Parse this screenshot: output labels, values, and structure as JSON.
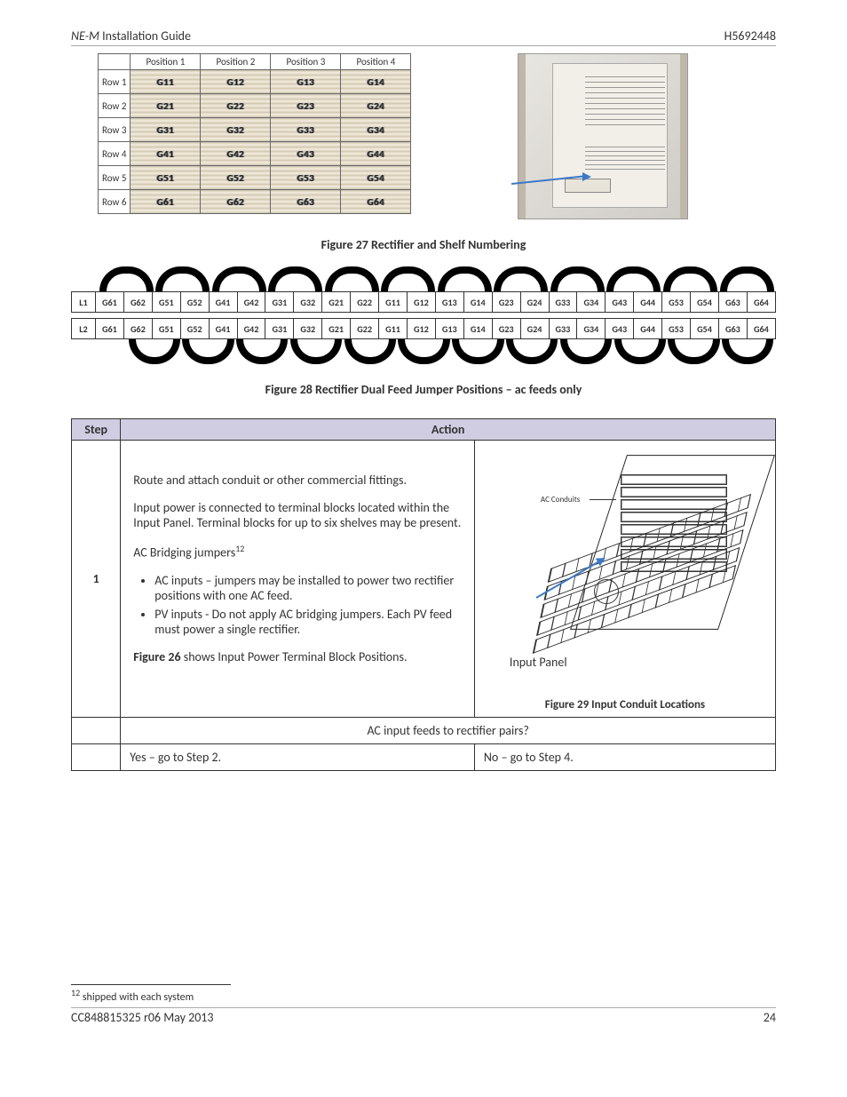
{
  "header": {
    "left_title": "NE-M",
    "left_suffix": " Installation Guide",
    "right": "H5692448"
  },
  "fig27": {
    "positions": [
      "Position 1",
      "Position 2",
      "Position 3",
      "Position 4"
    ],
    "rows": [
      {
        "label": "Row 1",
        "cells": [
          "G11",
          "G12",
          "G13",
          "G14"
        ]
      },
      {
        "label": "Row 2",
        "cells": [
          "G21",
          "G22",
          "G23",
          "G24"
        ]
      },
      {
        "label": "Row 3",
        "cells": [
          "G31",
          "G32",
          "G33",
          "G34"
        ]
      },
      {
        "label": "Row 4",
        "cells": [
          "G41",
          "G42",
          "G43",
          "G44"
        ]
      },
      {
        "label": "Row 5",
        "cells": [
          "G51",
          "G52",
          "G53",
          "G54"
        ]
      },
      {
        "label": "Row 6",
        "cells": [
          "G61",
          "G62",
          "G63",
          "G64"
        ]
      }
    ],
    "caption": "Figure 27 Rectifier and Shelf Numbering"
  },
  "fig28": {
    "rows": [
      {
        "head": "L1",
        "cells": [
          "G61",
          "G62",
          "G51",
          "G52",
          "G41",
          "G42",
          "G31",
          "G32",
          "G21",
          "G22",
          "G11",
          "G12",
          "G13",
          "G14",
          "G23",
          "G24",
          "G33",
          "G34",
          "G43",
          "G44",
          "G53",
          "G54",
          "G63",
          "G64"
        ]
      },
      {
        "head": "L2",
        "cells": [
          "G61",
          "G62",
          "G51",
          "G52",
          "G41",
          "G42",
          "G31",
          "G32",
          "G21",
          "G22",
          "G11",
          "G12",
          "G13",
          "G14",
          "G23",
          "G24",
          "G33",
          "G34",
          "G43",
          "G44",
          "G53",
          "G54",
          "G63",
          "G64"
        ]
      }
    ],
    "caption": "Figure 28 Rectifier Dual Feed Jumper Positions – ac feeds only"
  },
  "step_table": {
    "headers": {
      "step": "Step",
      "action": "Action"
    },
    "step_number": "1",
    "body": {
      "p1": "Route and attach conduit or other commercial fittings.",
      "p2": "Input power is connected to terminal blocks located within the Input Panel. Terminal blocks for up to six shelves may be present.",
      "p3_lead": "AC Bridging jumpers",
      "p3_footmark": "12",
      "li1": "AC inputs – jumpers may be installed to power two rectifier positions with one AC feed.",
      "li2": "PV inputs - Do not apply AC bridging jumpers. Each PV feed must power a single rectifier.",
      "p4_ref": "Figure 26",
      "p4_rest": " shows Input Power Terminal Block Positions."
    },
    "drawing": {
      "ac_conduits_label": "AC Conduits",
      "input_panel_label": "Input Panel",
      "caption": "Figure 29 Input Conduit Locations"
    },
    "question_row": "AC input feeds to rectifier pairs?",
    "yes_text": "Yes – go to Step 2.",
    "no_text": "No – go to Step 4."
  },
  "footnote": {
    "mark": "12",
    "text": " shipped with each system"
  },
  "footer": {
    "left": "CC848815325  r06   May 2013",
    "right": "24"
  }
}
